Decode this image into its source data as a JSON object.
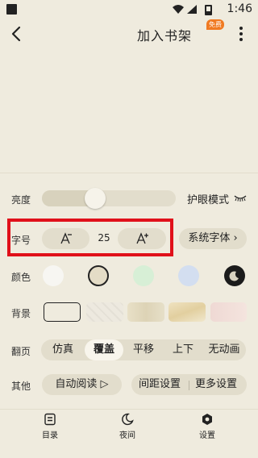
{
  "status_bar": {
    "time": "1:46"
  },
  "header": {
    "title": "加入书架",
    "badge": "免费"
  },
  "brightness": {
    "label": "亮度",
    "level_pct": 40,
    "eye_mode_label": "护眼模式"
  },
  "font": {
    "label": "字号",
    "size": "25",
    "system_font_label": "系统字体 ›"
  },
  "colors": {
    "label": "颜色",
    "swatches": [
      "#f7f6f2",
      "#e4dcc6",
      "#d7efd6",
      "#d3def0",
      "#1b1b1b"
    ],
    "selected_index": 1
  },
  "background": {
    "label": "背景"
  },
  "page_turn": {
    "label": "翻页",
    "options": [
      "仿真",
      "覆盖",
      "平移",
      "上下",
      "无动画"
    ],
    "selected_index": 1
  },
  "other": {
    "label": "其他",
    "auto_read_label": "自动阅读 ▷",
    "spacing_label": "间距设置",
    "more_label": "更多设置"
  },
  "tabs": [
    {
      "label": "目录",
      "icon": "catalog-icon"
    },
    {
      "label": "夜间",
      "icon": "moon-icon"
    },
    {
      "label": "设置",
      "icon": "settings-icon"
    }
  ]
}
